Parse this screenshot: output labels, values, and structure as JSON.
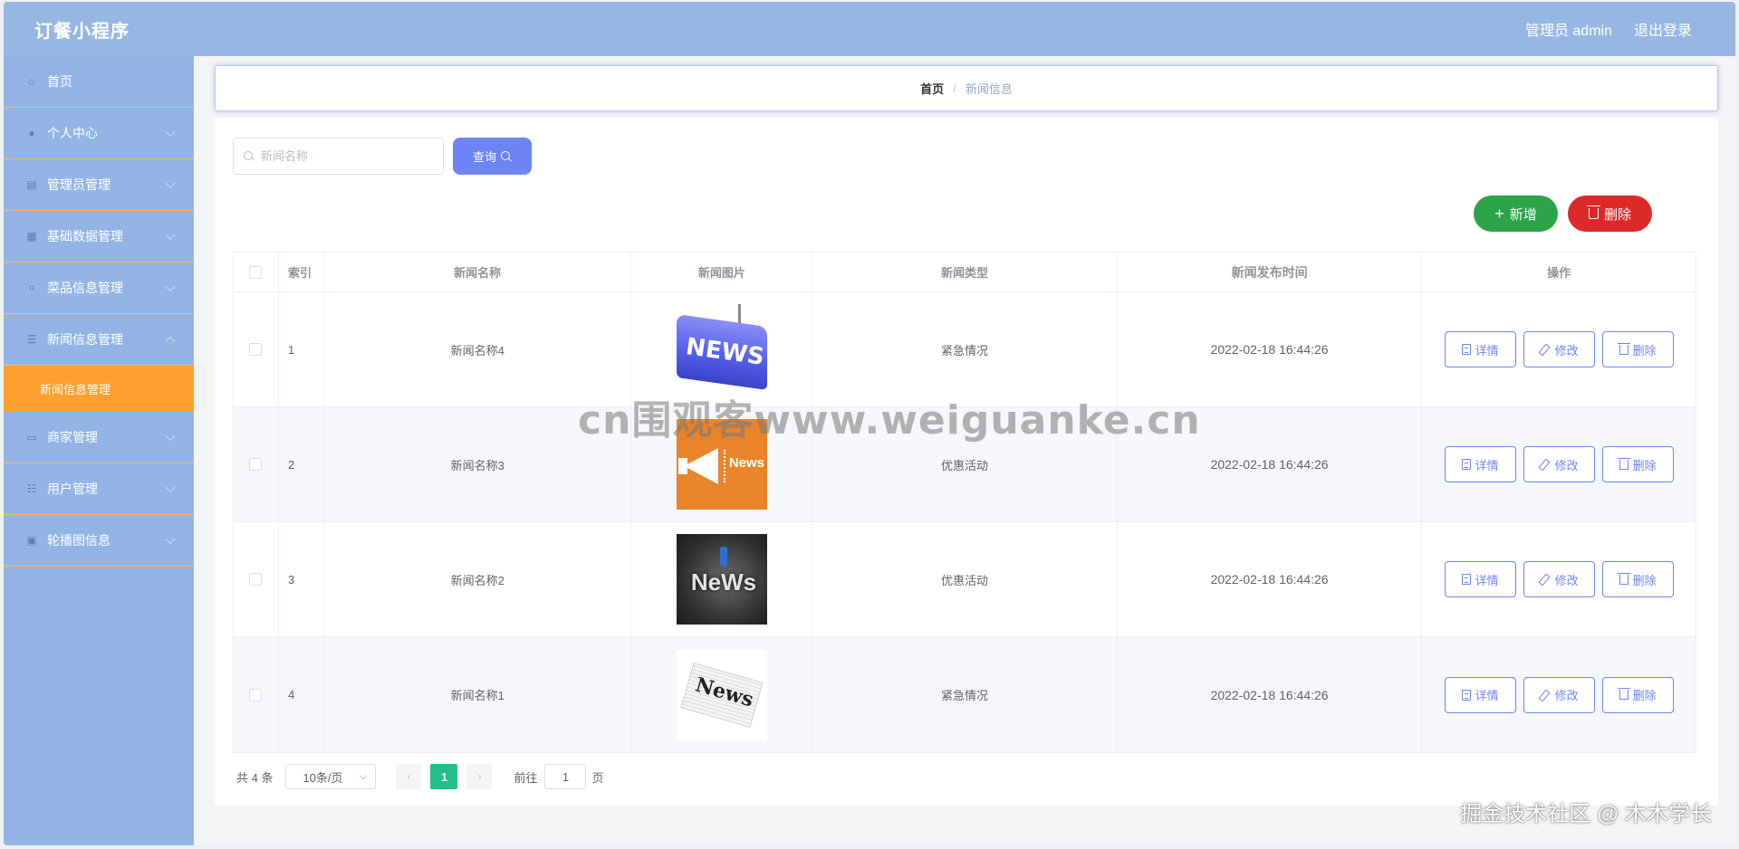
{
  "header": {
    "title": "订餐小程序",
    "admin_label": "管理员 admin",
    "logout_label": "退出登录"
  },
  "sidebar": {
    "items": [
      {
        "label": "首页",
        "icon": "home-icon"
      },
      {
        "label": "个人中心",
        "icon": "user-icon"
      },
      {
        "label": "管理员管理",
        "icon": "chart-icon"
      },
      {
        "label": "基础数据管理",
        "icon": "puzzle-icon"
      },
      {
        "label": "菜品信息管理",
        "icon": "crop-icon"
      },
      {
        "label": "新闻信息管理",
        "icon": "sliders-icon"
      },
      {
        "label": "商家管理",
        "icon": "card-icon"
      },
      {
        "label": "用户管理",
        "icon": "list-icon"
      },
      {
        "label": "轮播图信息",
        "icon": "image-icon"
      }
    ],
    "active_submenu": "新闻信息管理"
  },
  "breadcrumb": {
    "home": "首页",
    "current": "新闻信息"
  },
  "search": {
    "placeholder": "新闻名称",
    "query_label": "查询"
  },
  "actions": {
    "add_label": "新增",
    "delete_label": "删除"
  },
  "table": {
    "columns": [
      "索引",
      "新闻名称",
      "新闻图片",
      "新闻类型",
      "新闻发布时间",
      "操作"
    ],
    "rows": [
      {
        "index": "1",
        "name": "新闻名称4",
        "type": "紧急情况",
        "time": "2022-02-18 16:44:26",
        "image": "NEWS"
      },
      {
        "index": "2",
        "name": "新闻名称3",
        "type": "优惠活动",
        "time": "2022-02-18 16:44:26",
        "image": "News"
      },
      {
        "index": "3",
        "name": "新闻名称2",
        "type": "优惠活动",
        "time": "2022-02-18 16:44:26",
        "image": "NeWs"
      },
      {
        "index": "4",
        "name": "新闻名称1",
        "type": "紧急情况",
        "time": "2022-02-18 16:44:26",
        "image": "News"
      }
    ],
    "row_actions": {
      "detail": "详情",
      "edit": "修改",
      "delete": "删除"
    }
  },
  "pagination": {
    "total": "共 4 条",
    "page_size": "10条/页",
    "current_page": "1",
    "goto_label": "前往",
    "goto_value": "1",
    "page_suffix": "页"
  },
  "watermarks": {
    "center": "cn围观客www.weiguanke.cn",
    "corner": "掘金技术社区 @ 木木学长"
  },
  "colors": {
    "header_bg": "#97b7e3",
    "sidebar_bg": "#93b5e5",
    "active_submenu_bg": "#ff9f2f",
    "primary": "#6d84f4",
    "success": "#2da348",
    "danger": "#dc2a2a",
    "page_active": "#23c08a"
  }
}
